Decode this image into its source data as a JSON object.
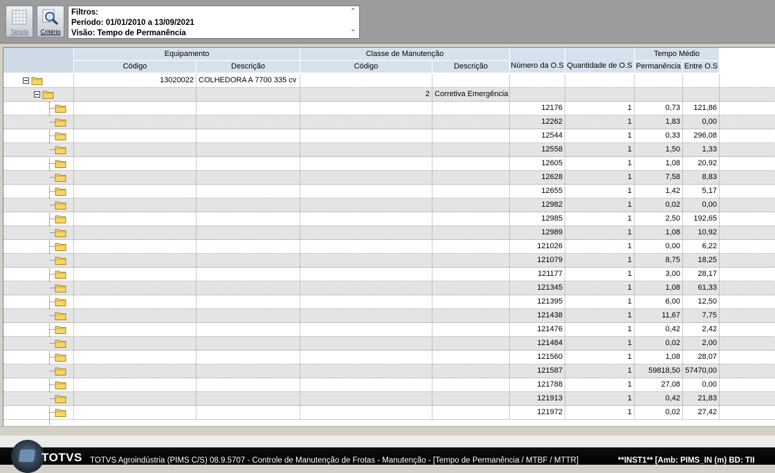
{
  "toolbar": {
    "buttons": [
      {
        "label": "Tabela",
        "icon": "grid-icon",
        "active": false
      },
      {
        "label": "Critério",
        "icon": "magnifier-icon",
        "active": true
      }
    ]
  },
  "filters": {
    "title": "Filtros:",
    "period": "Período: 01/01/2010 a 13/09/2021",
    "view": "Visão: Tempo de Permanência"
  },
  "grid": {
    "group_headers": {
      "equipamento": "Equipamento",
      "classe": "Classe de Manutenção",
      "tempo": "Tempo Médio"
    },
    "columns": {
      "equip_codigo": "Código",
      "equip_descricao": "Descrição",
      "classe_codigo": "Código",
      "classe_descricao": "Descrição",
      "numero_os": "Número da O.S",
      "quantidade_os": "Quantidade de O.S",
      "permanencia": "Permanência",
      "entre_os": "Entre O.S"
    },
    "level1": {
      "codigo": "13020022",
      "descricao": "COLHEDORA A 7700 335 cv"
    },
    "level2": {
      "codigo": "2",
      "descricao": "Corretiva Emergência"
    },
    "rows": [
      {
        "numero": "12176",
        "qtd": "1",
        "perm": "0,73",
        "entre": "121,86"
      },
      {
        "numero": "12262",
        "qtd": "1",
        "perm": "1,83",
        "entre": "0,00"
      },
      {
        "numero": "12544",
        "qtd": "1",
        "perm": "0,33",
        "entre": "296,08"
      },
      {
        "numero": "12558",
        "qtd": "1",
        "perm": "1,50",
        "entre": "1,33"
      },
      {
        "numero": "12605",
        "qtd": "1",
        "perm": "1,08",
        "entre": "20,92"
      },
      {
        "numero": "12628",
        "qtd": "1",
        "perm": "7,58",
        "entre": "8,83"
      },
      {
        "numero": "12655",
        "qtd": "1",
        "perm": "1,42",
        "entre": "5,17"
      },
      {
        "numero": "12982",
        "qtd": "1",
        "perm": "0,02",
        "entre": "0,00"
      },
      {
        "numero": "12985",
        "qtd": "1",
        "perm": "2,50",
        "entre": "192,65"
      },
      {
        "numero": "12989",
        "qtd": "1",
        "perm": "1,08",
        "entre": "10,92"
      },
      {
        "numero": "121026",
        "qtd": "1",
        "perm": "0,00",
        "entre": "6,22"
      },
      {
        "numero": "121079",
        "qtd": "1",
        "perm": "8,75",
        "entre": "18,25"
      },
      {
        "numero": "121177",
        "qtd": "1",
        "perm": "3,00",
        "entre": "28,17"
      },
      {
        "numero": "121345",
        "qtd": "1",
        "perm": "1,08",
        "entre": "61,33"
      },
      {
        "numero": "121395",
        "qtd": "1",
        "perm": "6,00",
        "entre": "12,50"
      },
      {
        "numero": "121438",
        "qtd": "1",
        "perm": "11,67",
        "entre": "7,75"
      },
      {
        "numero": "121476",
        "qtd": "1",
        "perm": "0,42",
        "entre": "2,42"
      },
      {
        "numero": "121484",
        "qtd": "1",
        "perm": "0,02",
        "entre": "2,00"
      },
      {
        "numero": "121560",
        "qtd": "1",
        "perm": "1,08",
        "entre": "28,07"
      },
      {
        "numero": "121587",
        "qtd": "1",
        "perm": "59818,50",
        "entre": "57470,00"
      },
      {
        "numero": "121788",
        "qtd": "1",
        "perm": "27,08",
        "entre": "0,00"
      },
      {
        "numero": "121913",
        "qtd": "1",
        "perm": "0,42",
        "entre": "21,83"
      },
      {
        "numero": "121972",
        "qtd": "1",
        "perm": "0,02",
        "entre": "27,42"
      }
    ]
  },
  "status": {
    "brand": "TOTVS",
    "text": "TOTVS Agroindústria (PIMS C/S) 08.9.5707 - Controle de Manutenção de Frotas - Manutenção - [Tempo de Permanência / MTBF / MTTR]",
    "env": "**INST1**    [Amb: PIMS_IN  (m) BD: TII"
  }
}
